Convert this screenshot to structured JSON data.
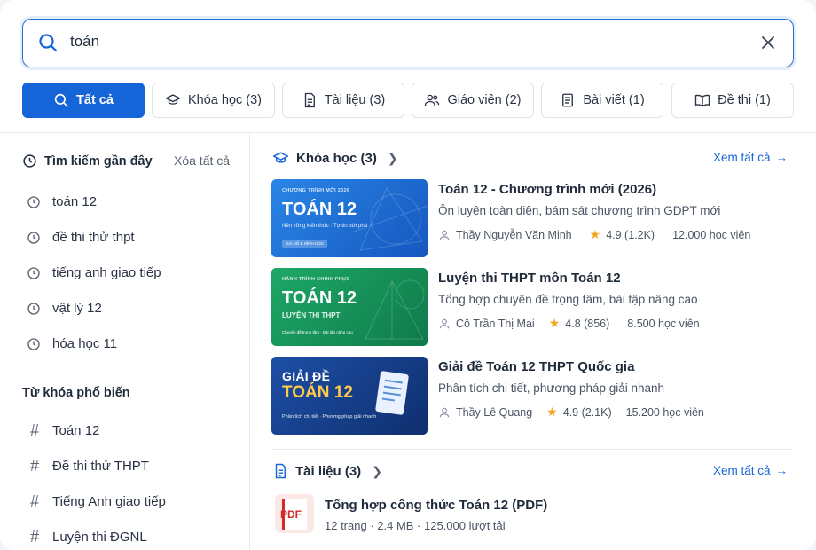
{
  "search": {
    "value": "toán"
  },
  "tabs": [
    {
      "label": "Tất cả",
      "icon": "search-icon"
    },
    {
      "label": "Khóa học (3)",
      "icon": "graduation-cap-icon"
    },
    {
      "label": "Tài liệu (3)",
      "icon": "document-icon"
    },
    {
      "label": "Giáo viên (2)",
      "icon": "users-icon"
    },
    {
      "label": "Bài viết (1)",
      "icon": "article-icon"
    },
    {
      "label": "Đề thi (1)",
      "icon": "book-icon"
    }
  ],
  "sidebar": {
    "recent_title": "Tìm kiếm gần đây",
    "clear_all": "Xóa tất cả",
    "recent": [
      "toán 12",
      "đề thi thử thpt",
      "tiếng anh giao tiếp",
      "vật lý 12",
      "hóa học 11"
    ],
    "popular_title": "Từ khóa phổ biến",
    "popular": [
      "Toán 12",
      "Đề thi thử THPT",
      "Tiếng Anh giao tiếp",
      "Luyện thi ĐGNL"
    ]
  },
  "courses_section": {
    "title": "Khóa học (3)",
    "see_all": "Xem tất cả"
  },
  "courses": [
    {
      "thumb_small": "CHƯƠNG TRÌNH MỚI 2026",
      "thumb_big": "TOÁN 12",
      "thumb_sub": "Nền vững kiến thức · Tự tin bứt phá",
      "thumb_tag": "ĐẠI SỐ & HÌNH HỌC",
      "title": "Toán 12 - Chương trình mới (2026)",
      "desc": "Ôn luyện toàn diện, bám sát chương trình GDPT mới",
      "teacher": "Thầy Nguyễn Văn Minh",
      "rating": "4.9 (1.2K)",
      "students": "12.000 học viên",
      "color": "#1e74d6"
    },
    {
      "thumb_small": "HÀNH TRÌNH CHINH PHỤC",
      "thumb_big": "TOÁN 12",
      "thumb_sub": "LUYỆN THI THPT",
      "thumb_tag": "Chuyên đề trọng tâm · Bài tập nâng cao",
      "title": "Luyện thi THPT môn Toán 12",
      "desc": "Tổng hợp chuyên đề trọng tâm, bài tập nâng cao",
      "teacher": "Cô Trần Thị Mai",
      "rating": "4.8 (856)",
      "students": "8.500 học viên",
      "color": "#15935c"
    },
    {
      "thumb_small": "GIẢI ĐỀ",
      "thumb_big": "TOÁN 12",
      "thumb_sub": "Phân tích chi tiết · Phương pháp giải nhanh",
      "thumb_tag": "",
      "title": "Giải đề Toán 12 THPT Quốc gia",
      "desc": "Phân tích chi tiết, phương pháp giải nhanh",
      "teacher": "Thầy Lê Quang",
      "rating": "4.9 (2.1K)",
      "students": "15.200 học viên",
      "color": "#163f8a"
    }
  ],
  "docs_section": {
    "title": "Tài liệu (3)",
    "see_all": "Xem tất cả"
  },
  "docs": [
    {
      "icon_label": "PDF",
      "title": "Tổng hợp công thức Toán 12 (PDF)",
      "meta": "12 trang · 2.4 MB · 125.000 lượt tải"
    }
  ]
}
